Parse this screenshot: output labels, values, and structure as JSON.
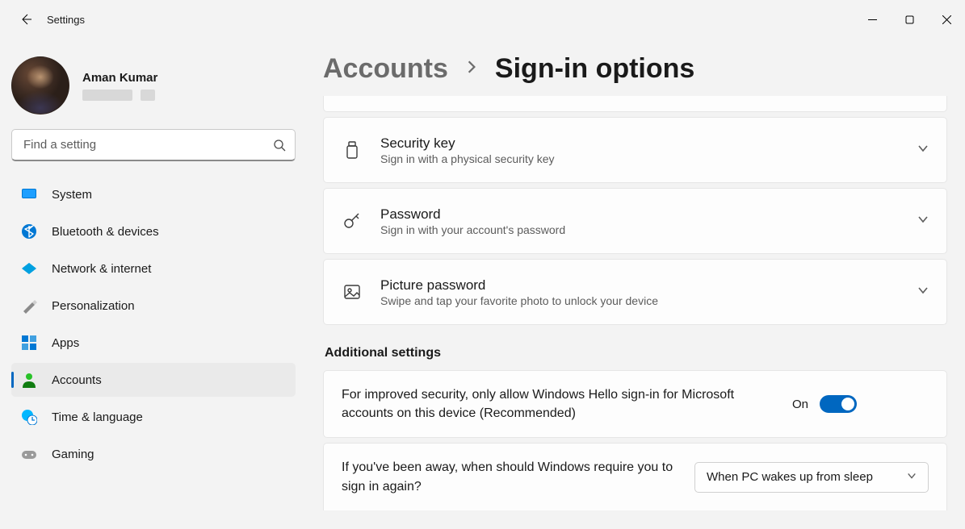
{
  "titlebar": {
    "app_title": "Settings"
  },
  "profile": {
    "name": "Aman Kumar"
  },
  "search": {
    "placeholder": "Find a setting"
  },
  "nav": {
    "items": [
      {
        "label": "System"
      },
      {
        "label": "Bluetooth & devices"
      },
      {
        "label": "Network & internet"
      },
      {
        "label": "Personalization"
      },
      {
        "label": "Apps"
      },
      {
        "label": "Accounts"
      },
      {
        "label": "Time & language"
      },
      {
        "label": "Gaming"
      }
    ]
  },
  "breadcrumb": {
    "parent": "Accounts",
    "current": "Sign-in options"
  },
  "options": [
    {
      "title": "Security key",
      "subtitle": "Sign in with a physical security key"
    },
    {
      "title": "Password",
      "subtitle": "Sign in with your account's password"
    },
    {
      "title": "Picture password",
      "subtitle": "Swipe and tap your favorite photo to unlock your device"
    }
  ],
  "additional": {
    "heading": "Additional settings",
    "hello": {
      "text": "For improved security, only allow Windows Hello sign-in for Microsoft accounts on this device (Recommended)",
      "state_label": "On"
    },
    "require_signin": {
      "text": "If you've been away, when should Windows require you to sign in again?",
      "selected": "When PC wakes up from sleep"
    }
  }
}
